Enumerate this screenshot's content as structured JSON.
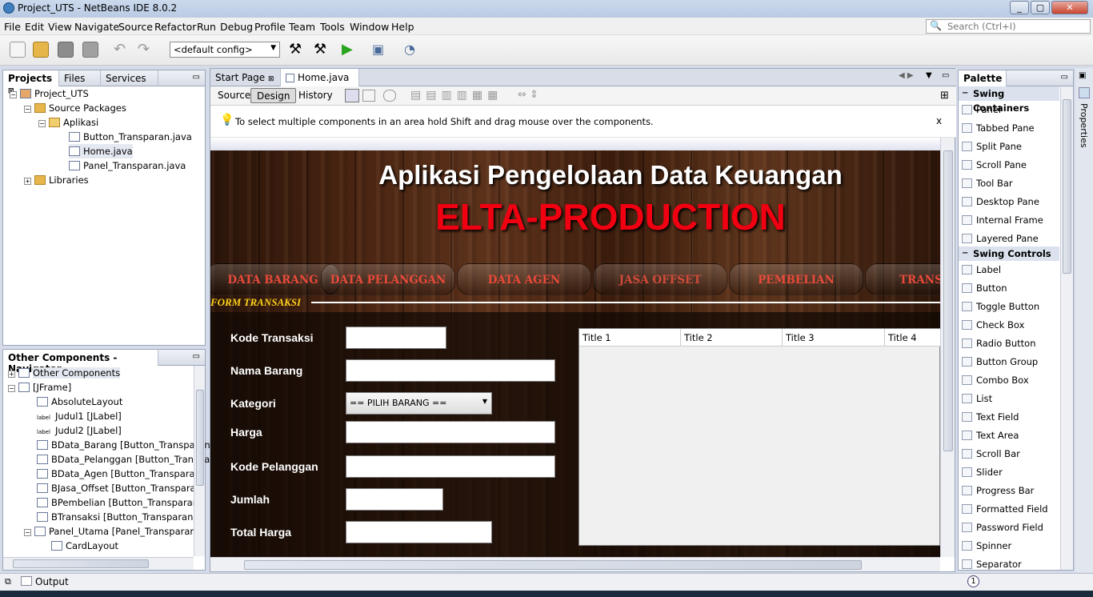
{
  "window": {
    "title": "Project_UTS - NetBeans IDE 8.0.2"
  },
  "menu": [
    "File",
    "Edit",
    "View",
    "Navigate",
    "Source",
    "Refactor",
    "Run",
    "Debug",
    "Profile",
    "Team",
    "Tools",
    "Window",
    "Help"
  ],
  "search": {
    "placeholder": "Search (Ctrl+I)"
  },
  "toolbar": {
    "config": "<default config>"
  },
  "projects_panel": {
    "tabs": [
      "Projects",
      "Files",
      "Services"
    ],
    "tree": [
      "Project_UTS",
      "Source Packages",
      "Aplikasi",
      "Button_Transparan.java",
      "Home.java",
      "Panel_Transparan.java",
      "Libraries"
    ]
  },
  "navigator": {
    "title": "Other Components - Navigator",
    "items": [
      "Other Components",
      "[JFrame]",
      "AbsoluteLayout",
      "Judul1 [JLabel]",
      "Judul2 [JLabel]",
      "BData_Barang [Button_Transparan]",
      "BData_Pelanggan [Button_Transpar",
      "BData_Agen [Button_Transparan]",
      "BJasa_Offset [Button_Transparan]",
      "BPembelian [Button_Transparan]",
      "BTransaksi [Button_Transparan]",
      "Panel_Utama [Panel_Transparan]",
      "CardLayout"
    ]
  },
  "editor": {
    "tabs": [
      "Start Page",
      "Home.java"
    ],
    "subtabs": [
      "Source",
      "Design",
      "History"
    ],
    "hint": "To select multiple components in an area hold Shift and drag mouse over the components.",
    "hint_close": "x"
  },
  "design": {
    "title1": "Aplikasi Pengelolaan Data Keuangan",
    "title2": "ELTA-PRODUCTION",
    "nav": [
      "DATA BARANG",
      "DATA PELANGGAN",
      "DATA AGEN",
      "JASA OFFSET",
      "PEMBELIAN",
      "TRANSA"
    ],
    "form_title": "FORM TRANSAKSI",
    "labels": [
      "Kode Transaksi",
      "Nama Barang",
      "Kategori",
      "Harga",
      "Kode Pelanggan",
      "Jumlah",
      "Total Harga"
    ],
    "combo": "== PILIH BARANG ==",
    "table_headers": [
      "Title 1",
      "Title 2",
      "Title 3",
      "Title 4"
    ]
  },
  "palette": {
    "title": "Palette",
    "cat1": "Swing Containers",
    "containers": [
      "Panel",
      "Tabbed Pane",
      "Split Pane",
      "Scroll Pane",
      "Tool Bar",
      "Desktop Pane",
      "Internal Frame",
      "Layered Pane"
    ],
    "cat2": "Swing Controls",
    "controls": [
      "Label",
      "Button",
      "Toggle Button",
      "Check Box",
      "Radio Button",
      "Button Group",
      "Combo Box",
      "List",
      "Text Field",
      "Text Area",
      "Scroll Bar",
      "Slider",
      "Progress Bar",
      "Formatted Field",
      "Password Field",
      "Spinner",
      "Separator"
    ]
  },
  "properties_label": "Properties",
  "status": {
    "output": "Output",
    "badge": "1"
  }
}
